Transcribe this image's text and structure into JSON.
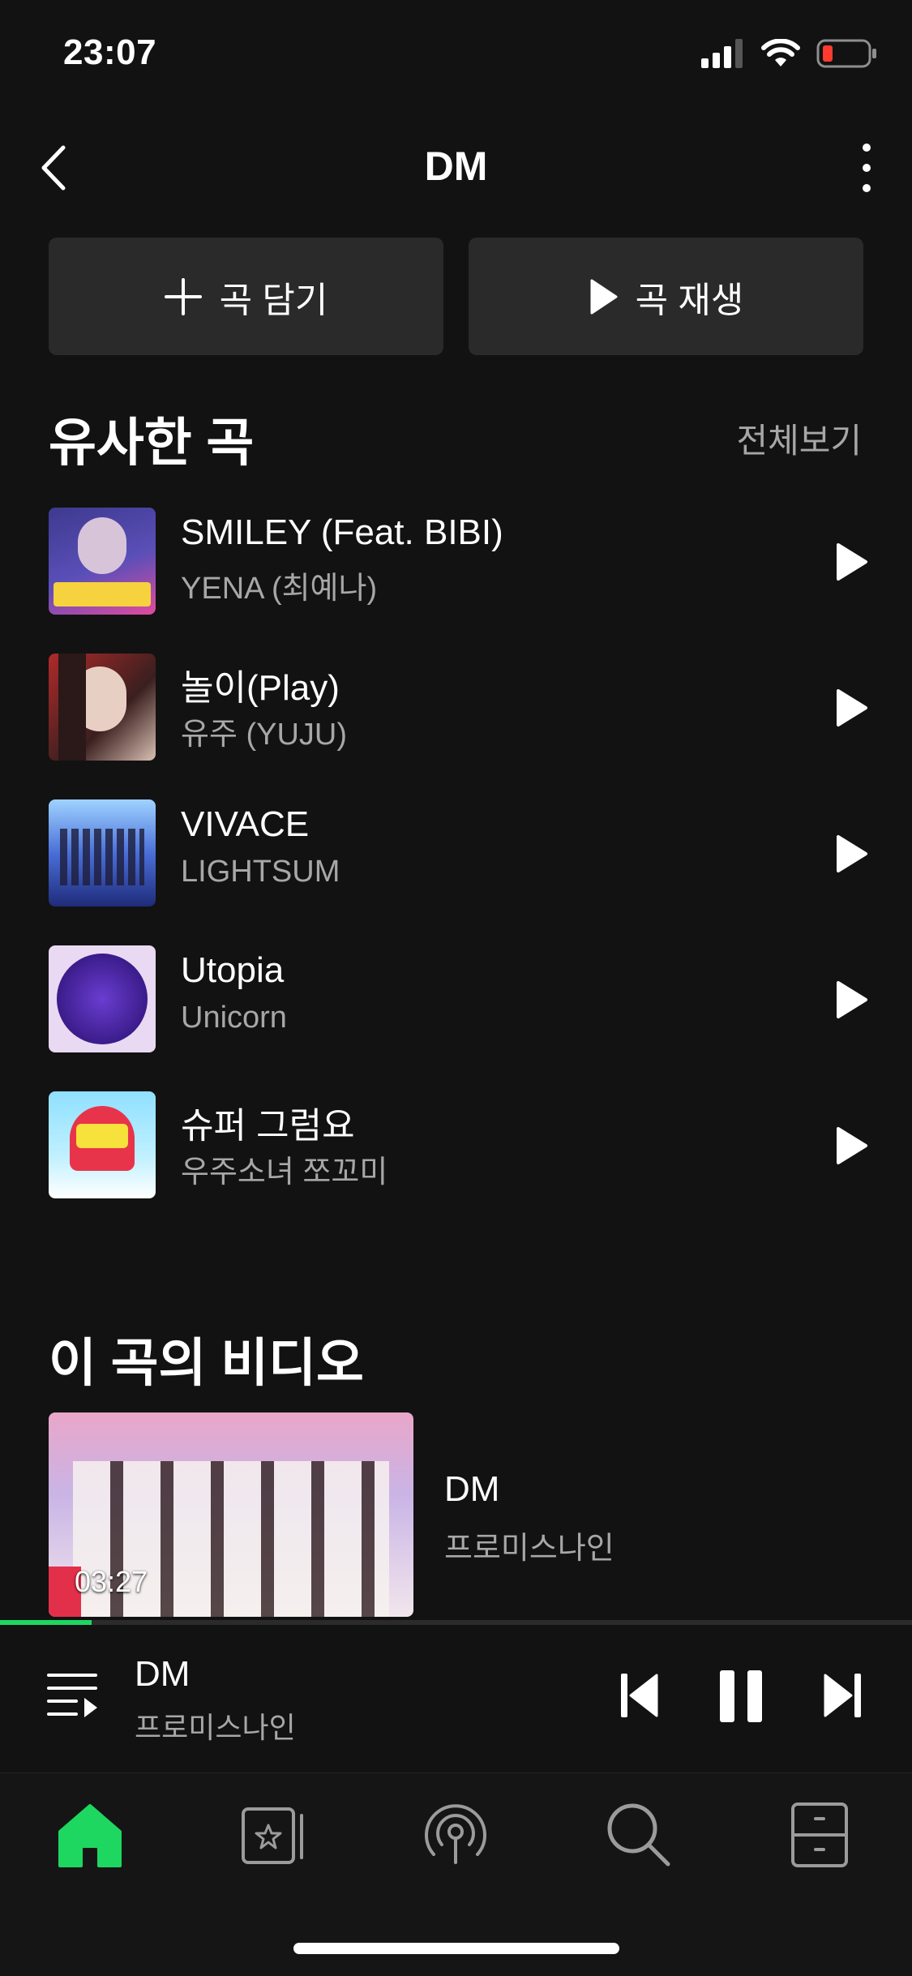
{
  "status_bar": {
    "time": "23:07"
  },
  "header": {
    "title": "DM"
  },
  "actions": {
    "add_label": "곡 담기",
    "play_label": "곡 재생"
  },
  "similar": {
    "title": "유사한 곡",
    "see_all": "전체보기",
    "songs": [
      {
        "title": "SMILEY (Feat. BIBI)",
        "artist": "YENA (최예나)"
      },
      {
        "title": "놀이(Play)",
        "artist": "유주 (YUJU)"
      },
      {
        "title": "VIVACE",
        "artist": "LIGHTSUM"
      },
      {
        "title": "Utopia",
        "artist": "Unicorn"
      },
      {
        "title": "슈퍼 그럼요",
        "artist": "우주소녀 쪼꼬미"
      }
    ]
  },
  "videos": {
    "title": "이 곡의 비디오",
    "items": [
      {
        "title": "DM",
        "artist": "프로미스나인",
        "duration": "03:27"
      }
    ]
  },
  "now_playing": {
    "title": "DM",
    "artist": "프로미스나인",
    "progress": 0.1
  },
  "colors": {
    "accent": "#1ed760",
    "background": "#121212",
    "button": "#2a2a2a"
  },
  "nav": [
    {
      "name": "home",
      "icon": "home-icon",
      "active": true
    },
    {
      "name": "library",
      "icon": "starred-playlist-icon",
      "active": false
    },
    {
      "name": "podcast",
      "icon": "podcast-icon",
      "active": false
    },
    {
      "name": "search",
      "icon": "search-icon",
      "active": false
    },
    {
      "name": "storage",
      "icon": "storage-icon",
      "active": false
    }
  ]
}
